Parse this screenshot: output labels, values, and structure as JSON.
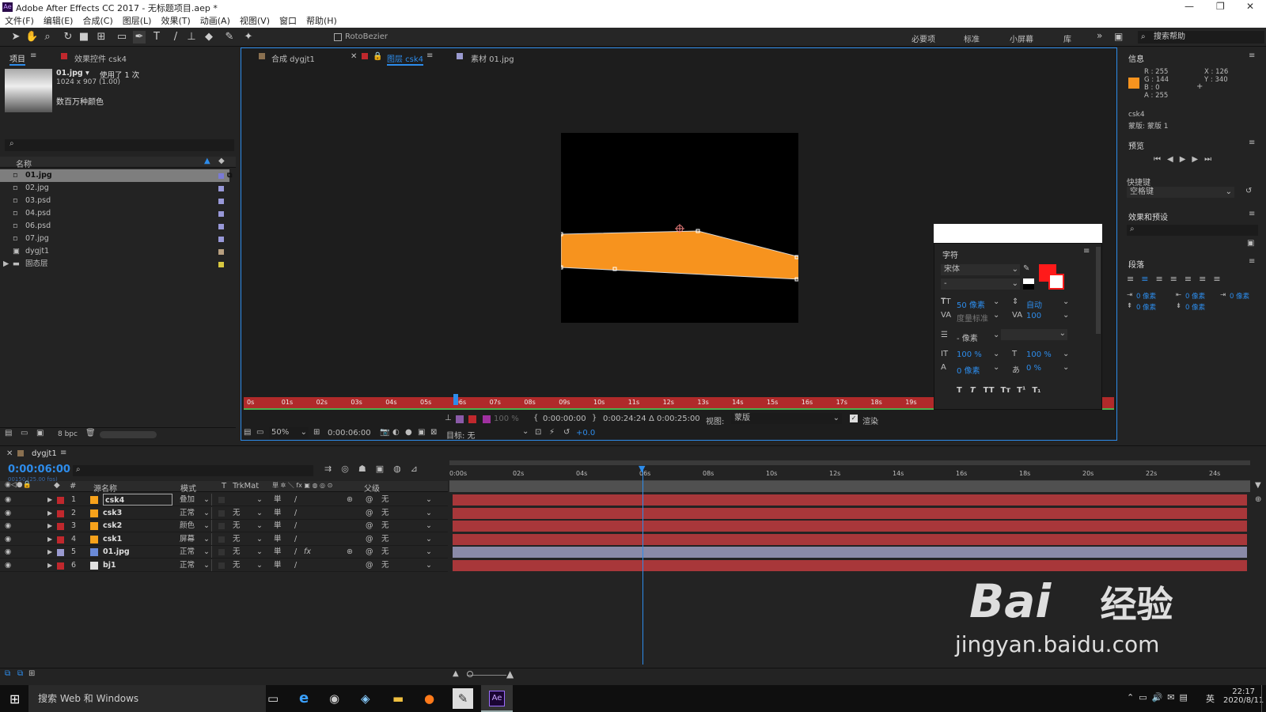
{
  "app": {
    "title": "Adobe After Effects CC 2017 - 无标题项目.aep *",
    "logo": "Ae"
  },
  "menu": [
    "文件(F)",
    "编辑(E)",
    "合成(C)",
    "图层(L)",
    "效果(T)",
    "动画(A)",
    "视图(V)",
    "窗口",
    "帮助(H)"
  ],
  "toolbar": {
    "rotobezier": "RotoBezier",
    "workspaces": [
      "必要项",
      "标准",
      "小屏幕",
      "库"
    ],
    "search_help": "搜索帮助"
  },
  "project": {
    "tab": "项目",
    "tab2": "效果控件 csk4",
    "file_name": "01.jpg ▾",
    "used": "使用了 1 次",
    "dims": "1024 x 907 (1.00)",
    "colors": "数百万种颜色",
    "col_name": "名称",
    "items": [
      {
        "name": "01.jpg",
        "color": "#7a7ad6",
        "selected": true
      },
      {
        "name": "02.jpg",
        "color": "#9898d8"
      },
      {
        "name": "03.psd",
        "color": "#9898d8"
      },
      {
        "name": "04.psd",
        "color": "#9898d8"
      },
      {
        "name": "06.psd",
        "color": "#9898d8"
      },
      {
        "name": "07.jpg",
        "color": "#9898d8"
      },
      {
        "name": "dygjt1",
        "color": "#b8a080"
      },
      {
        "name": "固态层",
        "color": "#d8c840"
      }
    ],
    "bpc": "8 bpc"
  },
  "viewer": {
    "tabs": [
      "合成 dygjt1",
      "图层 csk4",
      "素材 01.jpg"
    ],
    "ruler_ticks": [
      "0s",
      "01s",
      "02s",
      "03s",
      "04s",
      "05s",
      "06s",
      "07s",
      "08s",
      "09s",
      "10s",
      "11s",
      "12s",
      "13s",
      "14s",
      "15s",
      "16s",
      "17s",
      "18s",
      "19s",
      "2"
    ],
    "time_in": "0:00:00:00",
    "time_out": "0:00:24:24",
    "duration": "Δ 0:00:25:00",
    "view_label": "视图:",
    "view_value": "蒙版",
    "render": "渲染",
    "zoom": "50%",
    "time": "0:00:06:00",
    "target": "目标: 无",
    "exposure": "+0.0",
    "opacity": "100 %"
  },
  "info": {
    "title": "信息",
    "r": "R : 255",
    "g": "G : 144",
    "b": "B : 0",
    "a": "A : 255",
    "x": "X : 126",
    "y": "Y : 340",
    "layer": "csk4",
    "mask": "蒙版: 蒙版 1",
    "swatch": "#f7931e"
  },
  "preview": {
    "title": "预览",
    "shortcut_label": "快捷键",
    "shortcut": "空格键"
  },
  "effects": {
    "title": "效果和预设"
  },
  "paragraph": {
    "title": "段落",
    "v1": "0 像素",
    "v2": "0 像素",
    "v3": "0 像素",
    "v4": "0 像素",
    "v5": "0 像素"
  },
  "character": {
    "title": "字符",
    "font": "宋体",
    "style": "-",
    "size": "50 像素",
    "leading": "自动",
    "kerning": "度量标准",
    "tracking": "100",
    "stroke": "- 像素",
    "vscale": "100 %",
    "hscale": "100 %",
    "baseline": "0 像素",
    "tsume": "0 %",
    "styles": [
      "T",
      "T",
      "TT",
      "Tт",
      "T¹",
      "T₁"
    ]
  },
  "timeline": {
    "tab": "dygjt1",
    "time": "0:00:06:00",
    "fps": "00150 (25.00 fps)",
    "col_source": "源名称",
    "col_mode": "模式",
    "col_t": "T",
    "col_trkmat": "TrkMat",
    "col_parent": "父级",
    "ticks": [
      "0:00s",
      "02s",
      "04s",
      "06s",
      "08s",
      "10s",
      "12s",
      "14s",
      "16s",
      "18s",
      "20s",
      "22s",
      "24s"
    ],
    "playhead_seconds": 6,
    "duration_seconds": 25,
    "layers": [
      {
        "num": "1",
        "name": "csk4",
        "mode": "叠加",
        "trkmat": "",
        "parent": "无",
        "color": "#f7a21b",
        "label": "#c0282d",
        "bar": "#a8373a"
      },
      {
        "num": "2",
        "name": "csk3",
        "mode": "正常",
        "trkmat": "无",
        "parent": "无",
        "color": "#f7a21b",
        "label": "#c0282d",
        "bar": "#a8373a"
      },
      {
        "num": "3",
        "name": "csk2",
        "mode": "颜色",
        "trkmat": "无",
        "parent": "无",
        "color": "#f7a21b",
        "label": "#c0282d",
        "bar": "#a8373a"
      },
      {
        "num": "4",
        "name": "csk1",
        "mode": "屏幕",
        "trkmat": "无",
        "parent": "无",
        "color": "#f7a21b",
        "label": "#c0282d",
        "bar": "#a8373a"
      },
      {
        "num": "5",
        "name": "01.jpg",
        "mode": "正常",
        "trkmat": "无",
        "parent": "无",
        "color": "#6a8ad8",
        "label": "#9a9ad0",
        "bar": "#8a8aa8"
      },
      {
        "num": "6",
        "name": "bj1",
        "mode": "正常",
        "trkmat": "无",
        "parent": "无",
        "color": "#e0e0e0",
        "label": "#c0282d",
        "bar": "#a8373a"
      }
    ]
  },
  "taskbar": {
    "search": "搜索 Web 和 Windows",
    "time": "22:17",
    "date": "2020/8/11",
    "ime": "英"
  },
  "watermark": {
    "brand": "Bai",
    "brand2": "经验",
    "url": "jingyan.baidu.com"
  }
}
